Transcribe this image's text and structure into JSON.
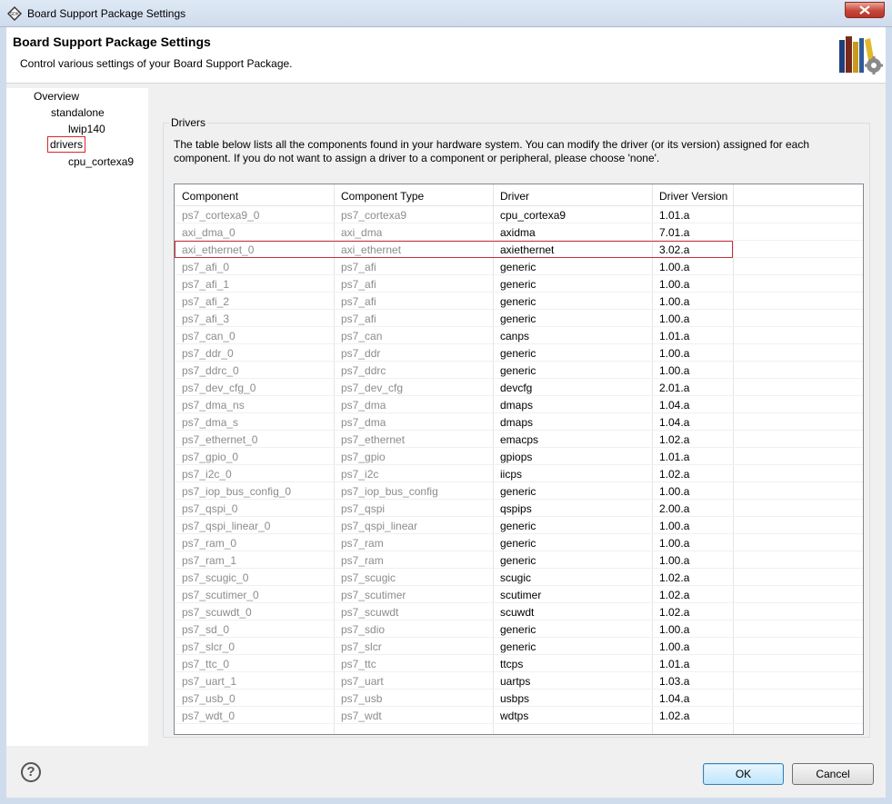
{
  "window": {
    "title": "Board Support Package Settings"
  },
  "header": {
    "title": "Board Support Package Settings",
    "description": "Control various settings of your Board Support Package."
  },
  "nav": [
    {
      "label": "Overview"
    },
    {
      "label": "standalone"
    },
    {
      "label": "lwip140"
    },
    {
      "label": "drivers",
      "selected": true
    },
    {
      "label": "cpu_cortexa9"
    }
  ],
  "drivers": {
    "legend": "Drivers",
    "description": "The table below lists all the components found in your hardware system. You can modify the driver (or its version) assigned for each component. If you do not want to assign a driver to a component or peripheral, please choose 'none'.",
    "columns": [
      "Component",
      "Component Type",
      "Driver",
      "Driver Version"
    ],
    "rows": [
      [
        "ps7_cortexa9_0",
        "ps7_cortexa9",
        "cpu_cortexa9",
        "1.01.a"
      ],
      [
        "axi_dma_0",
        "axi_dma",
        "axidma",
        "7.01.a"
      ],
      [
        "axi_ethernet_0",
        "axi_ethernet",
        "axiethernet",
        "3.02.a"
      ],
      [
        "ps7_afi_0",
        "ps7_afi",
        "generic",
        "1.00.a"
      ],
      [
        "ps7_afi_1",
        "ps7_afi",
        "generic",
        "1.00.a"
      ],
      [
        "ps7_afi_2",
        "ps7_afi",
        "generic",
        "1.00.a"
      ],
      [
        "ps7_afi_3",
        "ps7_afi",
        "generic",
        "1.00.a"
      ],
      [
        "ps7_can_0",
        "ps7_can",
        "canps",
        "1.01.a"
      ],
      [
        "ps7_ddr_0",
        "ps7_ddr",
        "generic",
        "1.00.a"
      ],
      [
        "ps7_ddrc_0",
        "ps7_ddrc",
        "generic",
        "1.00.a"
      ],
      [
        "ps7_dev_cfg_0",
        "ps7_dev_cfg",
        "devcfg",
        "2.01.a"
      ],
      [
        "ps7_dma_ns",
        "ps7_dma",
        "dmaps",
        "1.04.a"
      ],
      [
        "ps7_dma_s",
        "ps7_dma",
        "dmaps",
        "1.04.a"
      ],
      [
        "ps7_ethernet_0",
        "ps7_ethernet",
        "emacps",
        "1.02.a"
      ],
      [
        "ps7_gpio_0",
        "ps7_gpio",
        "gpiops",
        "1.01.a"
      ],
      [
        "ps7_i2c_0",
        "ps7_i2c",
        "iicps",
        "1.02.a"
      ],
      [
        "ps7_iop_bus_config_0",
        "ps7_iop_bus_config",
        "generic",
        "1.00.a"
      ],
      [
        "ps7_qspi_0",
        "ps7_qspi",
        "qspips",
        "2.00.a"
      ],
      [
        "ps7_qspi_linear_0",
        "ps7_qspi_linear",
        "generic",
        "1.00.a"
      ],
      [
        "ps7_ram_0",
        "ps7_ram",
        "generic",
        "1.00.a"
      ],
      [
        "ps7_ram_1",
        "ps7_ram",
        "generic",
        "1.00.a"
      ],
      [
        "ps7_scugic_0",
        "ps7_scugic",
        "scugic",
        "1.02.a"
      ],
      [
        "ps7_scutimer_0",
        "ps7_scutimer",
        "scutimer",
        "1.02.a"
      ],
      [
        "ps7_scuwdt_0",
        "ps7_scuwdt",
        "scuwdt",
        "1.02.a"
      ],
      [
        "ps7_sd_0",
        "ps7_sdio",
        "generic",
        "1.00.a"
      ],
      [
        "ps7_slcr_0",
        "ps7_slcr",
        "generic",
        "1.00.a"
      ],
      [
        "ps7_ttc_0",
        "ps7_ttc",
        "ttcps",
        "1.01.a"
      ],
      [
        "ps7_uart_1",
        "ps7_uart",
        "uartps",
        "1.03.a"
      ],
      [
        "ps7_usb_0",
        "ps7_usb",
        "usbps",
        "1.04.a"
      ],
      [
        "ps7_wdt_0",
        "ps7_wdt",
        "wdtps",
        "1.02.a"
      ]
    ],
    "highlighted_row": 2
  },
  "footer": {
    "help_icon": "question-mark-icon",
    "ok_label": "OK",
    "cancel_label": "Cancel"
  },
  "colors": {
    "highlight": "#c8303a",
    "dim_text": "#8c8c8c"
  }
}
